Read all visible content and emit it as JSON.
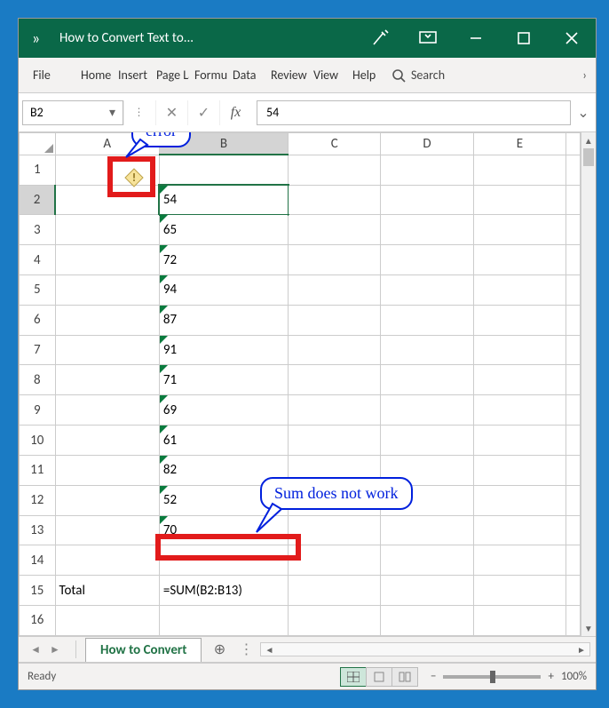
{
  "titlebar": {
    "more": "»",
    "title": "How to Convert Text to..."
  },
  "ribbon": {
    "file": "File",
    "home": "Home",
    "insert": "Insert",
    "page": "Page Layout",
    "formulas": "Formulas",
    "data": "Data",
    "review": "Review",
    "view": "View",
    "help": "Help",
    "search": "Search",
    "scroll": "›"
  },
  "formula_bar": {
    "name_box": "B2",
    "fx": "fx",
    "value": "54"
  },
  "columns": [
    "A",
    "B",
    "C",
    "D",
    "E"
  ],
  "rows": [
    {
      "n": "1",
      "a": "",
      "b": ""
    },
    {
      "n": "2",
      "a": "",
      "b": "54"
    },
    {
      "n": "3",
      "a": "",
      "b": "65"
    },
    {
      "n": "4",
      "a": "",
      "b": "72"
    },
    {
      "n": "5",
      "a": "",
      "b": "94"
    },
    {
      "n": "6",
      "a": "",
      "b": "87"
    },
    {
      "n": "7",
      "a": "",
      "b": "91"
    },
    {
      "n": "8",
      "a": "",
      "b": "71"
    },
    {
      "n": "9",
      "a": "",
      "b": "69"
    },
    {
      "n": "10",
      "a": "",
      "b": "61"
    },
    {
      "n": "11",
      "a": "",
      "b": "82"
    },
    {
      "n": "12",
      "a": "",
      "b": "52"
    },
    {
      "n": "13",
      "a": "",
      "b": "70"
    },
    {
      "n": "14",
      "a": "",
      "b": ""
    },
    {
      "n": "15",
      "a": "Total",
      "b": "=SUM(B2:B13)"
    },
    {
      "n": "16",
      "a": "",
      "b": ""
    }
  ],
  "sheet": {
    "tab": "How to Convert"
  },
  "status": {
    "ready": "Ready",
    "zoom": "100%"
  },
  "annotations": {
    "error_label": "error",
    "error_glyph": "!",
    "sum_label": "Sum does not work"
  }
}
